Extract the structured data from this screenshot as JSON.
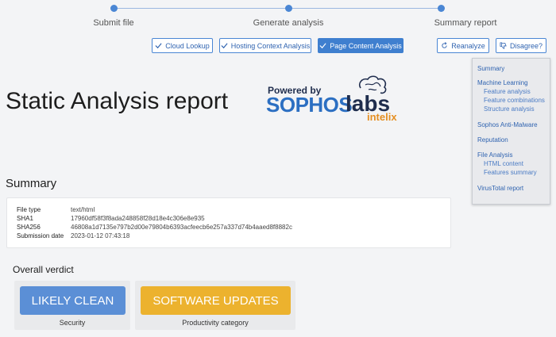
{
  "stepper": {
    "steps": [
      {
        "label": "Submit file"
      },
      {
        "label": "Generate analysis"
      },
      {
        "label": "Summary report"
      }
    ]
  },
  "toolbar": {
    "buttons": [
      {
        "label": "Cloud Lookup",
        "icon": "check-icon"
      },
      {
        "label": "Hosting Context Analysis",
        "icon": "check-icon"
      },
      {
        "label": "Page Content Analysis",
        "icon": "check-icon",
        "active": true
      },
      {
        "label": "Reanalyze",
        "icon": "refresh-icon"
      },
      {
        "label": "Disagree?",
        "icon": "thumbs-down-icon"
      }
    ]
  },
  "page": {
    "title": "Static Analysis report"
  },
  "logo": {
    "powered_by": "Powered by",
    "sophos": "SOPHOS",
    "labs": "labs",
    "intelix": "intelix"
  },
  "summary": {
    "title": "Summary",
    "rows": [
      {
        "key": "File type",
        "value": "text/html"
      },
      {
        "key": "SHA1",
        "value": "17960df58f3f8ada248858f28d18e4c306e8e935"
      },
      {
        "key": "SHA256",
        "value": "46808a1d7135e797b2d00e79804b6393acfeecb6e257a337d74b4aaed8f8882c"
      },
      {
        "key": "Submission date",
        "value": "2023-01-12 07:43:18"
      }
    ]
  },
  "verdict": {
    "title": "Overall verdict",
    "cards": [
      {
        "badge": "LIKELY CLEAN",
        "caption": "Security",
        "color": "#5b8fd6"
      },
      {
        "badge": "SOFTWARE UPDATES",
        "caption": "Productivity category",
        "color": "#ecb22e"
      }
    ]
  },
  "sidenav": {
    "items": [
      {
        "label": "Summary"
      },
      {
        "label": "Machine Learning"
      },
      {
        "label": "Feature analysis"
      },
      {
        "label": "Feature combinations"
      },
      {
        "label": "Structure analysis"
      },
      {
        "label": "Sophos Anti-Malware"
      },
      {
        "label": "Reputation"
      },
      {
        "label": "File Analysis"
      },
      {
        "label": "HTML content"
      },
      {
        "label": "Features summary"
      },
      {
        "label": "VirusTotal report"
      }
    ]
  },
  "colors": {
    "accent": "#3f7fcf",
    "clean": "#5b8fd6",
    "category": "#ecb22e"
  }
}
